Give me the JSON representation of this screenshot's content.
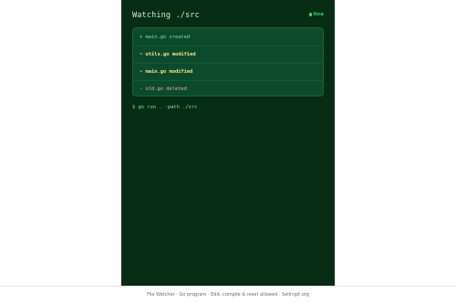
{
  "header": {
    "title": "Watching ./src",
    "status": "live"
  },
  "events": [
    {
      "text": "+ main.go created",
      "kind": "created"
    },
    {
      "text": "~ utils.go modified",
      "kind": "modified"
    },
    {
      "text": "~ main.go modified",
      "kind": "modified"
    },
    {
      "text": "- old.go deleted",
      "kind": "deleted"
    }
  ],
  "command": "$ go run . -path ./src",
  "footer": "File Watcher · Go program · Edit, compile & reset allowed · Sellingit.org",
  "colors": {
    "background": "#062c14",
    "live": "#37d67a",
    "created": "#7ee3a4",
    "modified": "#f2e58a",
    "deleted": "#e6b0a6"
  }
}
